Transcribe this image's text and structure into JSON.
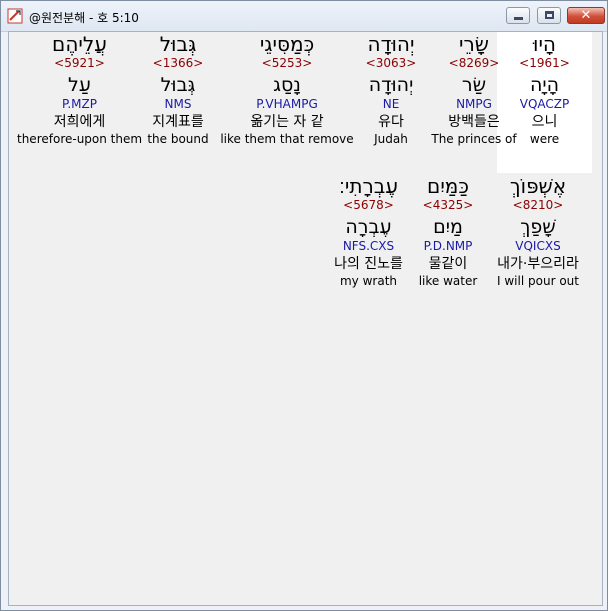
{
  "window": {
    "title": "@원전분해 - 호 5:10",
    "buttons": {
      "minimize": "minimize-icon",
      "maximize": "maximize-icon",
      "close": "close-icon"
    }
  },
  "rows": [
    {
      "words": [
        {
          "hebrew": "הָיוּ",
          "strong": "<1961>",
          "lemma": "הָיָה",
          "morph": "VQACZP",
          "korean": "으니",
          "english": "were",
          "selected": true
        },
        {
          "hebrew": "שָׂרֵי",
          "strong": "<8269>",
          "lemma": "שַׂר",
          "morph": "NMPG",
          "korean": "방백들은",
          "english": "The princes of",
          "selected": false
        },
        {
          "hebrew": "יְהוּדָה",
          "strong": "<3063>",
          "lemma": "יְהוּדָה",
          "morph": "NE",
          "korean": "유다",
          "english": "Judah",
          "selected": false
        },
        {
          "hebrew": "כְּמַסִּיגֵי",
          "strong": "<5253>",
          "lemma": "נָסַג",
          "morph": "P.VHAMPG",
          "korean": "옮기는 자 같",
          "english": "like them that remove",
          "selected": false
        },
        {
          "hebrew": "גְּבוּל",
          "strong": "<1366>",
          "lemma": "גְּבוּל",
          "morph": "NMS",
          "korean": "지계표를",
          "english": "the bound",
          "selected": false
        },
        {
          "hebrew": "עֲלֵיהֶם",
          "strong": "<5921>",
          "lemma": "עַל",
          "morph": "P.MZP",
          "korean": "저희에게",
          "english": "therefore-upon them",
          "selected": false
        }
      ]
    },
    {
      "words": [
        {
          "hebrew": "אֶשְׁפּוֹךְ",
          "strong": "<8210>",
          "lemma": "שָׁפַךְ",
          "morph": "VQICXS",
          "korean": "내가·부으리라",
          "english": "I will pour out",
          "selected": false
        },
        {
          "hebrew": "כַּמַּיִם",
          "strong": "<4325>",
          "lemma": "מַיִם",
          "morph": "P.D.NMP",
          "korean": "물같이",
          "english": "like water",
          "selected": false
        },
        {
          "hebrew": "עֶבְרָתִי׃",
          "strong": "<5678>",
          "lemma": "עֶבְרָה",
          "morph": "NFS.CXS",
          "korean": "나의 진노를",
          "english": "my wrath",
          "selected": false
        }
      ]
    }
  ]
}
